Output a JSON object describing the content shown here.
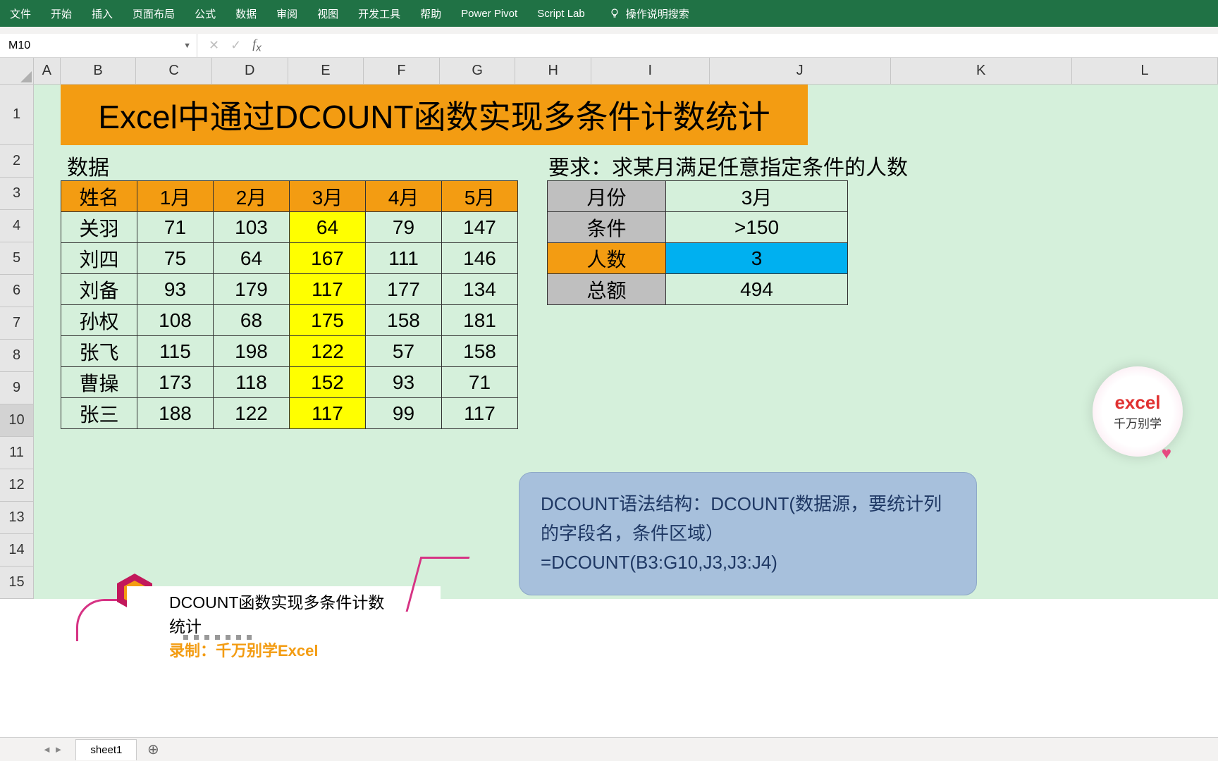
{
  "ribbon": {
    "tabs": [
      "文件",
      "开始",
      "插入",
      "页面布局",
      "公式",
      "数据",
      "审阅",
      "视图",
      "开发工具",
      "帮助",
      "Power Pivot",
      "Script Lab"
    ],
    "tell": "操作说明搜索"
  },
  "namebox": "M10",
  "columns": [
    "A",
    "B",
    "C",
    "D",
    "E",
    "F",
    "G",
    "H",
    "I",
    "J",
    "K",
    "L"
  ],
  "rows": [
    "1",
    "2",
    "3",
    "4",
    "5",
    "6",
    "7",
    "8",
    "9",
    "10",
    "11",
    "12",
    "13",
    "14",
    "15"
  ],
  "banner": "Excel中通过DCOUNT函数实现多条件计数统计",
  "label_data": "数据",
  "label_req": "要求：求某月满足任意指定条件的人数",
  "dtable": {
    "headers": [
      "姓名",
      "1月",
      "2月",
      "3月",
      "4月",
      "5月"
    ],
    "rows": [
      [
        "关羽",
        "71",
        "103",
        "64",
        "79",
        "147"
      ],
      [
        "刘四",
        "75",
        "64",
        "167",
        "111",
        "146"
      ],
      [
        "刘备",
        "93",
        "179",
        "117",
        "177",
        "134"
      ],
      [
        "孙权",
        "108",
        "68",
        "175",
        "158",
        "181"
      ],
      [
        "张飞",
        "115",
        "198",
        "122",
        "57",
        "158"
      ],
      [
        "曹操",
        "173",
        "118",
        "152",
        "93",
        "71"
      ],
      [
        "张三",
        "188",
        "122",
        "117",
        "99",
        "117"
      ]
    ],
    "highlight_col": 3
  },
  "ctable": [
    {
      "k": "月份",
      "v": "3月",
      "cls": ""
    },
    {
      "k": "条件",
      "v": ">150",
      "cls": ""
    },
    {
      "k": "人数",
      "v": "3",
      "cls": "orng"
    },
    {
      "k": "总额",
      "v": "494",
      "cls": ""
    }
  ],
  "syntax": {
    "l1": "DCOUNT语法结构：DCOUNT(数据源，要统计列的字段名，条件区域）",
    "l2": "=DCOUNT(B3:G10,J3,J3:J4)"
  },
  "caption": {
    "title": "DCOUNT函数实现多条件计数统计",
    "author": "录制：千万别学Excel"
  },
  "badge": {
    "l1": "excel",
    "l2": "千万别学"
  },
  "sheet": "sheet1"
}
